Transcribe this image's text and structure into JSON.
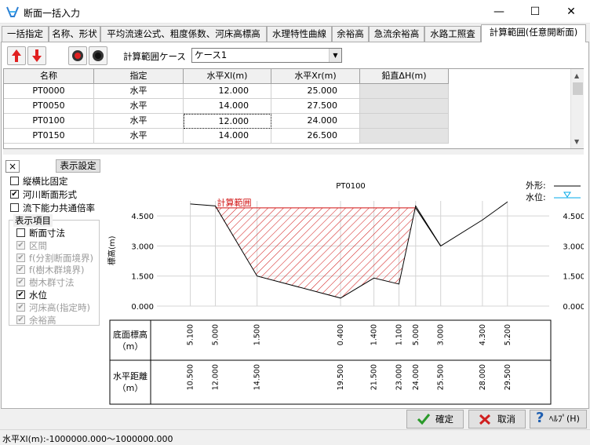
{
  "window": {
    "title": "断面一括入力"
  },
  "tabs": [
    {
      "label": "一括指定"
    },
    {
      "label": "名称、形状"
    },
    {
      "label": "平均流速公式、粗度係数、河床高標高"
    },
    {
      "label": "水理特性曲線"
    },
    {
      "label": "余裕高"
    },
    {
      "label": "急流余裕高"
    },
    {
      "label": "水路工照査"
    },
    {
      "label": "計算範囲(任意開断面)"
    }
  ],
  "toolbar": {
    "case_label": "計算範囲ケース",
    "case_value": "ケース1"
  },
  "grid": {
    "headers": [
      "名称",
      "指定",
      "水平Xl(m)",
      "水平Xr(m)",
      "鉛直ΔH(m)"
    ],
    "rows": [
      {
        "name": "PT0000",
        "spec": "水平",
        "xl": "12.000",
        "xr": "25.000"
      },
      {
        "name": "PT0050",
        "spec": "水平",
        "xl": "14.000",
        "xr": "27.500"
      },
      {
        "name": "PT0100",
        "spec": "水平",
        "xl": "12.000",
        "xr": "24.000"
      },
      {
        "name": "PT0150",
        "spec": "水平",
        "xl": "14.000",
        "xr": "26.500"
      }
    ]
  },
  "left": {
    "close_label": "×",
    "display_settings_label": "表示設定",
    "options": [
      {
        "label": "縦横比固定",
        "checked": false
      },
      {
        "label": "河川断面形式",
        "checked": true
      },
      {
        "label": "流下能力共通倍率",
        "checked": false
      }
    ],
    "group_label": "表示項目",
    "items": [
      {
        "label": "断面寸法",
        "checked": false,
        "enabled": true
      },
      {
        "label": "区間",
        "checked": true,
        "enabled": false
      },
      {
        "label": "f(分割断面境界)",
        "checked": true,
        "enabled": false
      },
      {
        "label": "f(樹木群境界)",
        "checked": true,
        "enabled": false
      },
      {
        "label": "樹木群寸法",
        "checked": true,
        "enabled": false
      },
      {
        "label": "水位",
        "checked": true,
        "enabled": true
      },
      {
        "label": "河床高(指定時)",
        "checked": true,
        "enabled": false
      },
      {
        "label": "余裕高",
        "checked": true,
        "enabled": false
      }
    ]
  },
  "chart_data": {
    "type": "line",
    "title": "PT0100",
    "ylabel": "標高(m)",
    "y_ticks": [
      "4.500",
      "3.000",
      "1.500",
      "0.000"
    ],
    "ylim": [
      0,
      5.25
    ],
    "xlim": [
      8.5,
      32
    ],
    "legend": [
      {
        "label": "外形:"
      },
      {
        "label": "水位:"
      }
    ],
    "range_label": "計算範囲",
    "range": {
      "xl": 12.0,
      "xr": 24.0
    },
    "water_level": 4.9,
    "series": [
      {
        "name": "外形",
        "x": [
          10.5,
          12.0,
          14.5,
          19.5,
          21.5,
          23.0,
          24.0,
          25.5,
          28.0,
          29.5
        ],
        "y": [
          5.1,
          5.0,
          1.5,
          0.4,
          1.4,
          1.1,
          5.0,
          3.0,
          4.3,
          5.2
        ]
      }
    ],
    "table": {
      "row1_label": "底面標高\n（m）",
      "row2_label": "水平距離\n（m）",
      "elevations": [
        "5.100",
        "5.000",
        "1.500",
        "0.400",
        "1.400",
        "1.100",
        "5.000",
        "3.000",
        "4.300",
        "5.200"
      ],
      "distances": [
        "10.500",
        "12.000",
        "14.500",
        "19.500",
        "21.500",
        "23.000",
        "24.000",
        "25.500",
        "28.000",
        "29.500"
      ]
    }
  },
  "buttons": {
    "ok": "確定",
    "cancel": "取消",
    "help": "ﾍﾙﾌﾟ(H)"
  },
  "status": {
    "text": "水平Xl(m):-1000000.000～1000000.000"
  },
  "colors": {
    "range": "#d01010",
    "water": "#00a8e8",
    "accent_red": "#e02020"
  }
}
